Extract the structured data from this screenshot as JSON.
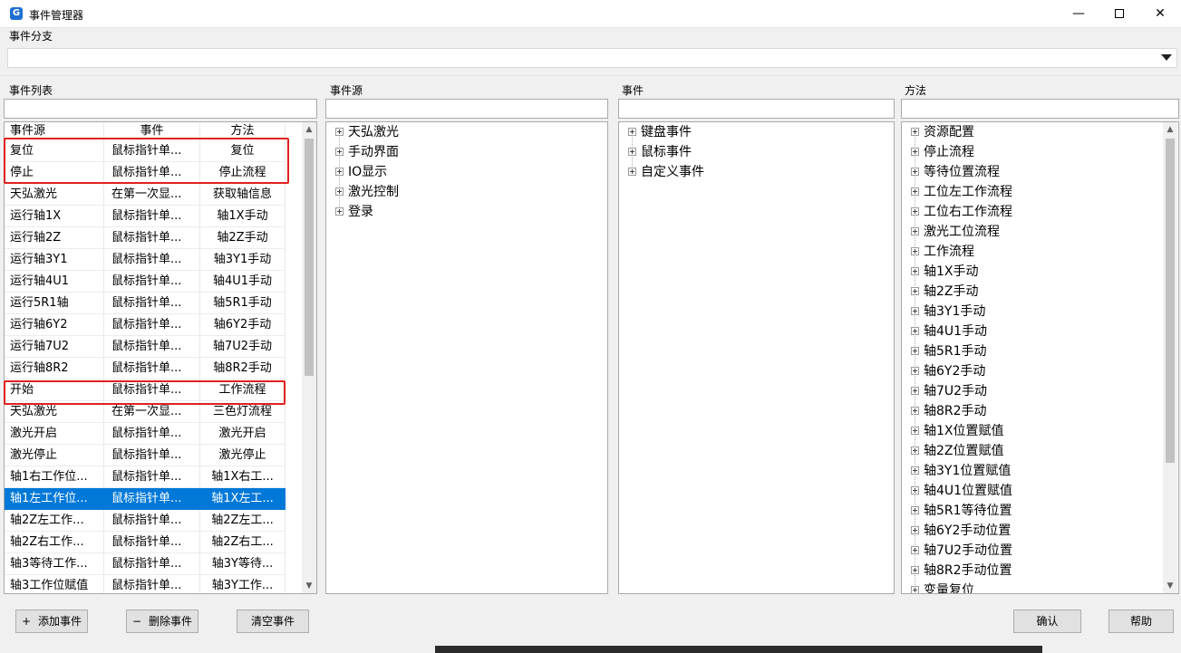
{
  "window": {
    "title": "事件管理器",
    "icon": "app-logo-icon",
    "controls": {
      "minimize": "—",
      "maximize": "☐",
      "close": "✕"
    }
  },
  "branch": {
    "label": "事件分支",
    "value": ""
  },
  "event_list": {
    "label": "事件列表",
    "filter_value": "",
    "columns": [
      "事件源",
      "事件",
      "方法"
    ],
    "rows": [
      [
        "复位",
        "鼠标指针单...",
        "复位"
      ],
      [
        "停止",
        "鼠标指针单...",
        "停止流程"
      ],
      [
        "天弘激光",
        "在第一次显...",
        "获取轴信息"
      ],
      [
        "运行轴1X",
        "鼠标指针单...",
        "轴1X手动"
      ],
      [
        "运行轴2Z",
        "鼠标指针单...",
        "轴2Z手动"
      ],
      [
        "运行轴3Y1",
        "鼠标指针单...",
        "轴3Y1手动"
      ],
      [
        "运行轴4U1",
        "鼠标指针单...",
        "轴4U1手动"
      ],
      [
        "运行5R1轴",
        "鼠标指针单...",
        "轴5R1手动"
      ],
      [
        "运行轴6Y2",
        "鼠标指针单...",
        "轴6Y2手动"
      ],
      [
        "运行轴7U2",
        "鼠标指针单...",
        "轴7U2手动"
      ],
      [
        "运行轴8R2",
        "鼠标指针单...",
        "轴8R2手动"
      ],
      [
        "开始",
        "鼠标指针单...",
        "工作流程"
      ],
      [
        "天弘激光",
        "在第一次显...",
        "三色灯流程"
      ],
      [
        "激光开启",
        "鼠标指针单...",
        "激光开启"
      ],
      [
        "激光停止",
        "鼠标指针单...",
        "激光停止"
      ],
      [
        "轴1右工作位...",
        "鼠标指针单...",
        "轴1X右工..."
      ],
      [
        "轴1左工作位...",
        "鼠标指针单...",
        "轴1X左工..."
      ],
      [
        "轴2Z左工作...",
        "鼠标指针单...",
        "轴2Z左工..."
      ],
      [
        "轴2Z右工作...",
        "鼠标指针单...",
        "轴2Z右工..."
      ],
      [
        "轴3等待工作...",
        "鼠标指针单...",
        "轴3Y等待..."
      ],
      [
        "轴3工作位赋值",
        "鼠标指针单...",
        "轴3Y工作..."
      ]
    ],
    "selected_index": 16
  },
  "event_source": {
    "label": "事件源",
    "filter_value": "",
    "items": [
      "天弘激光",
      "手动界面",
      "IO显示",
      "激光控制",
      "登录"
    ]
  },
  "events": {
    "label": "事件",
    "filter_value": "",
    "items": [
      "键盘事件",
      "鼠标事件",
      "自定义事件"
    ]
  },
  "methods": {
    "label": "方法",
    "filter_value": "",
    "items": [
      "资源配置",
      "停止流程",
      "等待位置流程",
      "工位左工作流程",
      "工位右工作流程",
      "激光工位流程",
      "工作流程",
      "轴1X手动",
      "轴2Z手动",
      "轴3Y1手动",
      "轴4U1手动",
      "轴5R1手动",
      "轴6Y2手动",
      "轴7U2手动",
      "轴8R2手动",
      "轴1X位置赋值",
      "轴2Z位置赋值",
      "轴3Y1位置赋值",
      "轴4U1位置赋值",
      "轴5R1等待位置",
      "轴6Y2手动位置",
      "轴7U2手动位置",
      "轴8R2手动位置",
      "变量复位"
    ]
  },
  "buttons": {
    "add": {
      "icon": "+",
      "label": "添加事件"
    },
    "delete": {
      "icon": "−",
      "label": "删除事件"
    },
    "clear": {
      "label": "清空事件"
    },
    "confirm": {
      "label": "确认"
    },
    "help": {
      "label": "帮助"
    }
  },
  "colors": {
    "selection": "#0078d7",
    "annotation": "#e02020"
  }
}
